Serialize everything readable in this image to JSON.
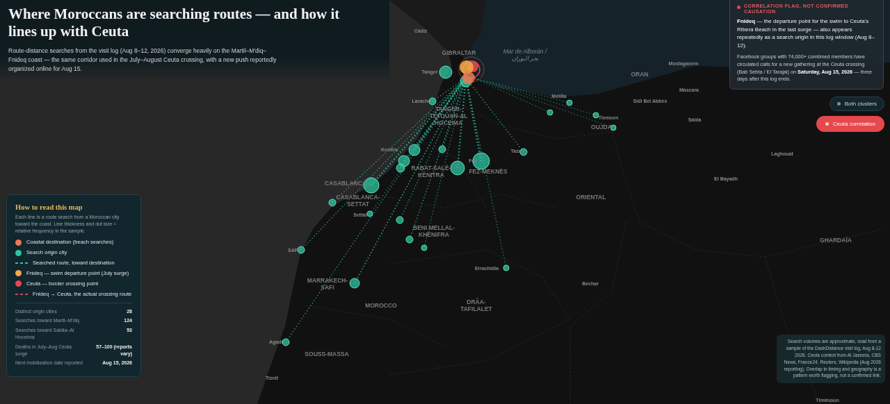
{
  "header": {
    "title": "Where Moroccans are searching routes — and how it lines up with Ceuta",
    "subtitle": "Route-distance searches from the visit log (Aug 8–12, 2026) converge heavily on the Martil–M'diq–Fnideq coast — the same corridor used in the July–August Ceuta crossing, with a new push reportedly organized online for Aug 15."
  },
  "map": {
    "labels": [
      {
        "text": "Cádiz",
        "kind": "city"
      },
      {
        "text": "GIBRALTAR",
        "kind": "region"
      },
      {
        "text": "Mar de Alborán / بحر البوران",
        "kind": "sea"
      },
      {
        "text": "Tanger",
        "kind": "city"
      },
      {
        "text": "TANGER-TÉTOUAN-AL HOCEIMA",
        "kind": "region"
      },
      {
        "text": "Larache",
        "kind": "city"
      },
      {
        "text": "Melilla",
        "kind": "city"
      },
      {
        "text": "Mostaganem",
        "kind": "city"
      },
      {
        "text": "ORAN",
        "kind": "region"
      },
      {
        "text": "Mascara",
        "kind": "city"
      },
      {
        "text": "Sidi Bel Abbès",
        "kind": "city"
      },
      {
        "text": "Tlemcen",
        "kind": "city"
      },
      {
        "text": "Saïda",
        "kind": "city"
      },
      {
        "text": "OUJDA",
        "kind": "region"
      },
      {
        "text": "Taza",
        "kind": "city"
      },
      {
        "text": "Kenitra",
        "kind": "city"
      },
      {
        "text": "RABAT-SALÉ-KÉNITRA",
        "kind": "region"
      },
      {
        "text": "Fez",
        "kind": "city"
      },
      {
        "text": "FEZ-MEKNÈS",
        "kind": "region"
      },
      {
        "text": "Laghouat",
        "kind": "city"
      },
      {
        "text": "El Bayadh",
        "kind": "city"
      },
      {
        "text": "CASABLANCA",
        "kind": "region"
      },
      {
        "text": "CASABLANCA-SETTAT",
        "kind": "region"
      },
      {
        "text": "ORIENTAL",
        "kind": "region"
      },
      {
        "text": "Settat",
        "kind": "city"
      },
      {
        "text": "BENI MELLAL-KHÉNIFRA",
        "kind": "region"
      },
      {
        "text": "GHARDAÏA",
        "kind": "region"
      },
      {
        "text": "SAFI",
        "kind": "city"
      },
      {
        "text": "Errachidia",
        "kind": "city"
      },
      {
        "text": "Bechar",
        "kind": "city"
      },
      {
        "text": "MARRAKECH-SAFI",
        "kind": "region"
      },
      {
        "text": "MOROCCO",
        "kind": "region"
      },
      {
        "text": "DRÂA-TAFILALET",
        "kind": "region"
      },
      {
        "text": "Agadir",
        "kind": "city"
      },
      {
        "text": "SOUSS-MASSA",
        "kind": "region"
      },
      {
        "text": "Tiznit",
        "kind": "city"
      },
      {
        "text": "Timimoun",
        "kind": "city"
      }
    ]
  },
  "flag_panel": {
    "tag": "CORRELATION FLAG, NOT CONFIRMED CAUSATION",
    "lead": "**Fnideq** — the departure point for the swim to Ceuta's Ribera Beach in the last surge — also appears repeatedly as a search origin in this log window (Aug 8–12).",
    "detail": "Facebook groups with 74,000+ combined members have circulated calls for a new gathering at the Ceuta crossing (Bab Sebta / El Tarajal) on **Saturday, Aug 15, 2026** — three days after this log ends."
  },
  "view_buttons": [
    {
      "label": "Both clusters",
      "selected": false
    },
    {
      "label": "Ceuta correlation",
      "selected": true
    }
  ],
  "legend": {
    "title": "How to read this map",
    "intro": "Each line is a route search from a Moroccan city toward the coast. Line thickness and dot size = relative frequency in the sample.",
    "items": [
      {
        "kind": "dot",
        "color": "#ef7a55",
        "label": "Coastal destination (beach searches)"
      },
      {
        "kind": "dot",
        "color": "#2ec4a0",
        "label": "Search origin city"
      },
      {
        "kind": "dash",
        "color": "#2ec4a0",
        "label": "Searched route, toward destination"
      },
      {
        "kind": "dot",
        "color": "#f0a848",
        "label": "Fnideq — swim departure point (July surge)"
      },
      {
        "kind": "dot",
        "color": "#e5484d",
        "label": "Ceuta — border crossing point"
      },
      {
        "kind": "dash",
        "color": "#c0506a",
        "label": "Fnideq → Ceuta, the actual crossing route"
      }
    ],
    "stats": [
      {
        "label": "Distinct origin cities",
        "value": "28"
      },
      {
        "label": "Searches toward Martil–M'diq",
        "value": "124"
      },
      {
        "label": "Searches toward Saïdia–Al Hoceima",
        "value": "53"
      },
      {
        "label": "Deaths in July–Aug Ceuta surge",
        "value": "57–100 (reports vary)"
      },
      {
        "label": "Next mobilization date reported",
        "value": "Aug 15, 2026"
      }
    ]
  },
  "source_note": "Search volumes are approximate, read from a sample of the DashDistance visit log, Aug 8-12 2026. Ceuta context from Al Jazeera, CBS News, France24, Reuters, Wikipedia (Aug 2026 reporting). Overlap in timing and geography is a pattern worth flagging, not a confirmed link."
}
